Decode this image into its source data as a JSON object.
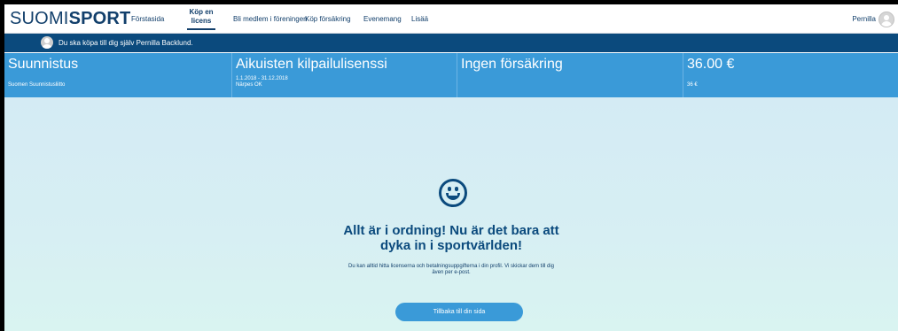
{
  "brand": {
    "logo_plain": "SUOMI",
    "logo_bold": "SPORT"
  },
  "nav": {
    "items": [
      "Förstasida",
      "Bli medlem i föreningen",
      "Köp försäkring",
      "Evenemang",
      "Lisää"
    ],
    "active_line1": "Köp en",
    "active_line2": "licens",
    "user_name": "Pernilla"
  },
  "buyer_bar": {
    "text": "Du ska köpa till dig själv Pernilla Backlund."
  },
  "summary": {
    "sport": {
      "title": "Suunnistus",
      "sub": "Suomen Suunnistusliitto"
    },
    "license": {
      "title": "Aikuisten kilpailulisenssi",
      "dates": "1.1.2018 - 31.12.2018",
      "club": "Närpes OK"
    },
    "insurance": {
      "title": "Ingen försäkring"
    },
    "price": {
      "title": "36.00 €",
      "sub": "36 €"
    }
  },
  "confirmation": {
    "headline_line1": "Allt är i ordning! Nu är det bara att",
    "headline_line2": "dyka in i sportvärlden!",
    "info_line1": "Du kan alltid hitta licenserna och betalningsuppgifterna i din profil. Vi skickar dem till dig",
    "info_line2": "även per e-post.",
    "back_button": "Tillbaka till din sida"
  },
  "colors": {
    "navy": "#0b4a7d",
    "summary_blue": "#3a9ad8",
    "content_bg": "#d4ebf4"
  },
  "icons": [
    "user-avatar-icon",
    "smiley-icon"
  ]
}
